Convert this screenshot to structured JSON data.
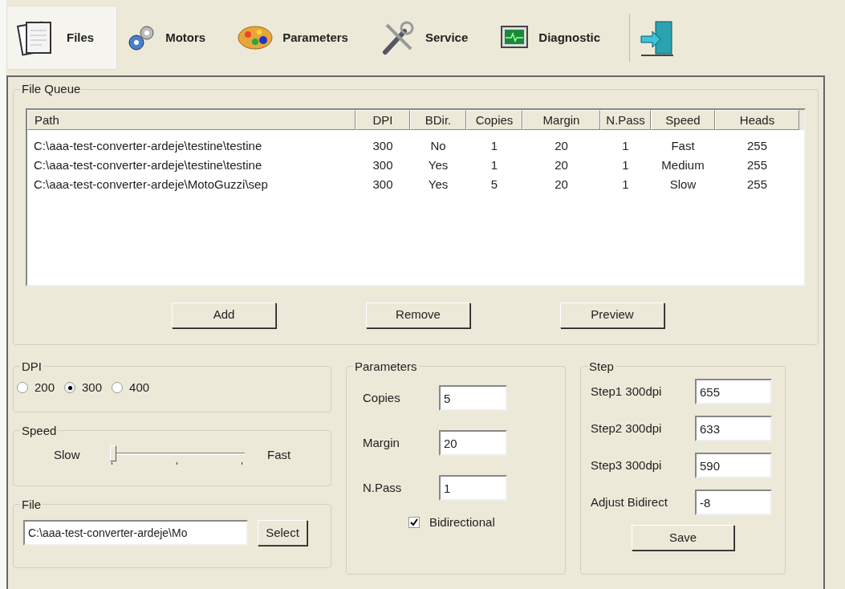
{
  "toolbar": {
    "tabs": [
      {
        "label": "Files",
        "kind": "files",
        "selected": true
      },
      {
        "label": "Motors",
        "kind": "gears",
        "selected": false
      },
      {
        "label": "Parameters",
        "kind": "palette",
        "selected": false
      },
      {
        "label": "Service",
        "kind": "tools",
        "selected": false
      },
      {
        "label": "Diagnostic",
        "kind": "monitor",
        "selected": false
      }
    ]
  },
  "file_queue": {
    "title": "File Queue",
    "columns": [
      "Path",
      "DPI",
      "BDir.",
      "Copies",
      "Margin",
      "N.Pass",
      "Speed",
      "Heads"
    ],
    "rows": [
      [
        "C:\\aaa-test-converter-ardeje\\testine\\testine",
        "300",
        "No",
        "1",
        "20",
        "1",
        "Fast",
        "255"
      ],
      [
        "C:\\aaa-test-converter-ardeje\\testine\\testine",
        "300",
        "Yes",
        "1",
        "20",
        "1",
        "Medium",
        "255"
      ],
      [
        "C:\\aaa-test-converter-ardeje\\MotoGuzzi\\sep",
        "300",
        "Yes",
        "5",
        "20",
        "1",
        "Slow",
        "255"
      ]
    ],
    "buttons": [
      "Add",
      "Remove",
      "Preview"
    ]
  },
  "dpi": {
    "title": "DPI",
    "options": [
      {
        "label": "200",
        "selected": false
      },
      {
        "label": "300",
        "selected": true
      },
      {
        "label": "400",
        "selected": false
      }
    ]
  },
  "speed": {
    "title": "Speed",
    "min_label": "Slow",
    "max_label": "Fast",
    "level": 0
  },
  "file": {
    "title": "File",
    "value": "C:\\aaa-test-converter-ardeje\\Mo",
    "button": "Select"
  },
  "parameters": {
    "title": "Parameters",
    "fields": [
      {
        "label": "Copies",
        "value": "5"
      },
      {
        "label": "Margin",
        "value": "20"
      },
      {
        "label": "N.Pass",
        "value": "1"
      }
    ],
    "bidirectional": {
      "label": "Bidirectional",
      "checked": true
    }
  },
  "step": {
    "title": "Step",
    "fields": [
      {
        "label": "Step1 300dpi",
        "value": "655"
      },
      {
        "label": "Step2 300dpi",
        "value": "633"
      },
      {
        "label": "Step3 300dpi",
        "value": "590"
      },
      {
        "label": "Adjust Bidirect",
        "value": "-8"
      }
    ],
    "button": "Save"
  }
}
